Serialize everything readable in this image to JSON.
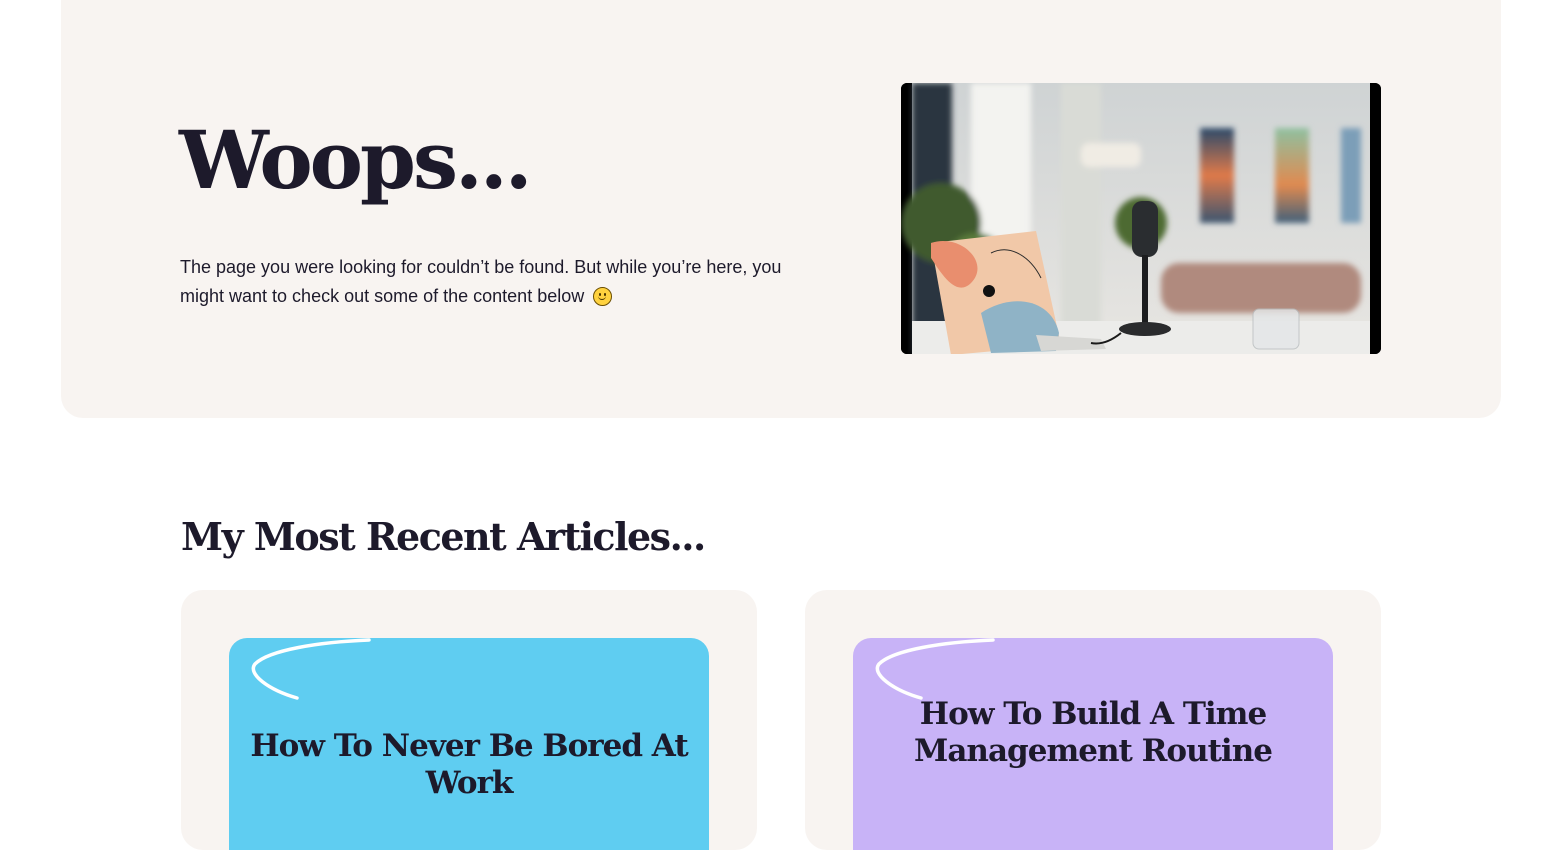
{
  "hero": {
    "title": "Woops...",
    "text": "The page you were looking for couldn’t be found. But while you’re here, you might want to check out some of the content below",
    "emoji_icon": "smiling-face-icon",
    "image_alt": "Laptop and podcast microphone on a desk in a bright studio"
  },
  "recent": {
    "heading": "My Most Recent Articles...",
    "articles": [
      {
        "title": "How To Never Be Bored At Work",
        "color": "#5fcdf1"
      },
      {
        "title": "How To Build A Time Management Routine",
        "color": "#c8b3f7"
      }
    ]
  },
  "colors": {
    "hero_bg": "#f8f4f1",
    "text": "#1d1a2b",
    "card_bg": "#f8f4f1"
  }
}
